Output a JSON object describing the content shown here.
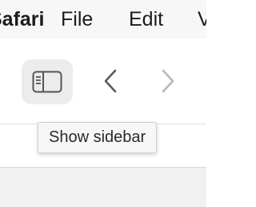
{
  "menubar": {
    "app_name": "Safari",
    "items": [
      "File",
      "Edit",
      "View"
    ]
  },
  "toolbar": {
    "sidebar_button_icon": "sidebar-icon",
    "back_icon": "chevron-left-icon",
    "forward_icon": "chevron-right-icon"
  },
  "tooltip": {
    "text": "Show sidebar"
  },
  "colors": {
    "icon_active": "#5a5a5a",
    "icon_disabled": "#b8b8b8",
    "button_bg": "#ececec"
  }
}
